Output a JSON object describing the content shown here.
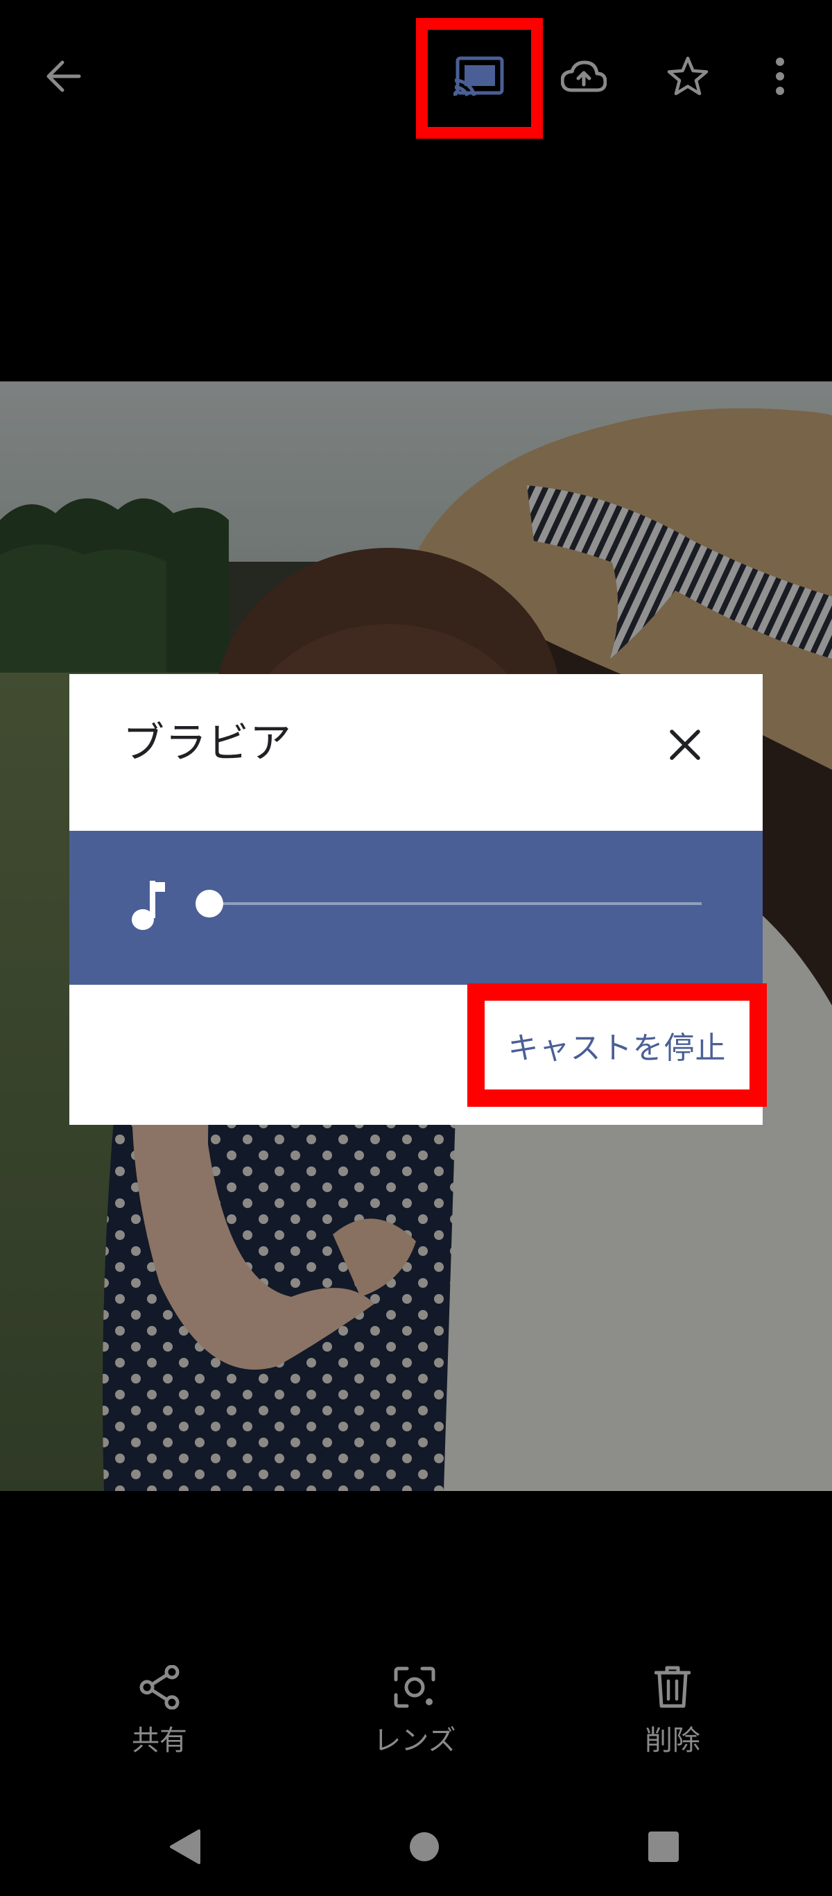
{
  "colors": {
    "highlight": "#ff0000",
    "dialog_accent": "#4a5f95",
    "dialog_background": "#ffffff",
    "icon_gray": "#8a8a8a",
    "title_text": "#202124"
  },
  "toolbar": {
    "back_icon": "arrow-left-icon",
    "cast_icon": "cast-connected-icon",
    "backup_icon": "cloud-upload-icon",
    "favorite_icon": "star-outline-icon",
    "more_icon": "more-vertical-icon"
  },
  "dialog": {
    "title": "ブラビア",
    "close_icon": "close-icon",
    "volume_icon": "music-note-icon",
    "volume_level": 0.0,
    "stop_button_label": "キャストを停止"
  },
  "actions": [
    {
      "label": "共有",
      "icon": "share-icon"
    },
    {
      "label": "レンズ",
      "icon": "lens-icon"
    },
    {
      "label": "削除",
      "icon": "trash-icon"
    }
  ],
  "system_nav": {
    "back_icon": "triangle-back-icon",
    "home_icon": "circle-home-icon",
    "recents_icon": "square-recents-icon"
  }
}
